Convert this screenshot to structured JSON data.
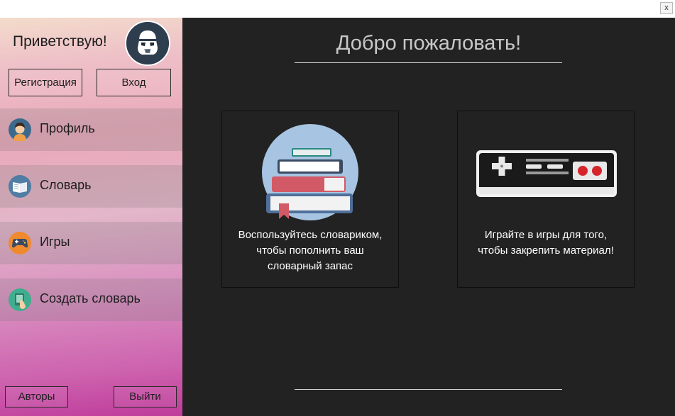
{
  "window": {
    "close_label": "x"
  },
  "sidebar": {
    "greeting": "Приветствую!",
    "avatar_icon": "stormtrooper-avatar-icon",
    "register_label": "Регистрация",
    "login_label": "Вход",
    "nav": [
      {
        "label": "Профиль",
        "icon": "profile-icon"
      },
      {
        "label": "Словарь",
        "icon": "book-icon"
      },
      {
        "label": "Игры",
        "icon": "gamepad-icon"
      },
      {
        "label": "Создать словарь",
        "icon": "create-dictionary-icon"
      }
    ],
    "authors_label": "Авторы",
    "exit_label": "Выйти"
  },
  "main": {
    "welcome": "Добро пожаловать!",
    "cards": [
      {
        "text_line1": "Воспользуйтесь словариком,",
        "text_line2": "чтобы пополнить ваш",
        "text_line3": "словарный запас",
        "icon": "books-stack-icon"
      },
      {
        "text_line1": "Играйте в игры для того,",
        "text_line2": "чтобы закрепить материал!",
        "icon": "game-controller-icon"
      }
    ]
  },
  "colors": {
    "main_bg": "#222222",
    "sidebar_gradient_top": "#f3dccb",
    "sidebar_gradient_bottom": "#bf3c9b"
  }
}
